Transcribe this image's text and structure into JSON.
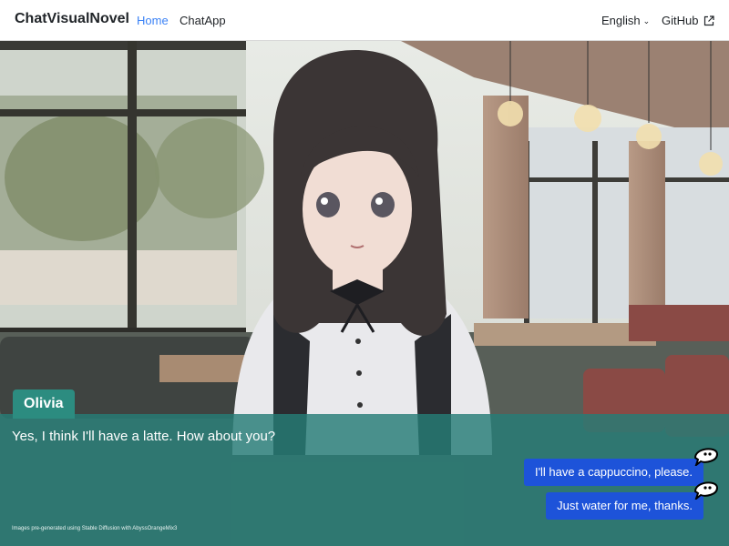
{
  "navbar": {
    "brand": "ChatVisualNovel",
    "links": [
      {
        "label": "Home",
        "active": true
      },
      {
        "label": "ChatApp",
        "active": false
      }
    ],
    "language": "English",
    "github": "GitHub"
  },
  "dialog": {
    "speaker": "Olivia",
    "text": "Yes, I think I'll have a latte. How about you?",
    "replies": [
      {
        "label": "I'll have a cappuccino, please."
      },
      {
        "label": "Just water for me, thanks."
      }
    ],
    "credit": "Images pre-generated using Stable Diffusion with AbyssOrangeMix3"
  },
  "colors": {
    "accent": "#3b82f6",
    "dialog_bg": "#267d76",
    "name_tag": "#2c8c80",
    "reply_button": "#1d53d9"
  },
  "icons": {
    "language_menu": "chevron-down-icon",
    "github_link": "external-link-icon",
    "reply_hint": "speech-bubble-icon"
  }
}
